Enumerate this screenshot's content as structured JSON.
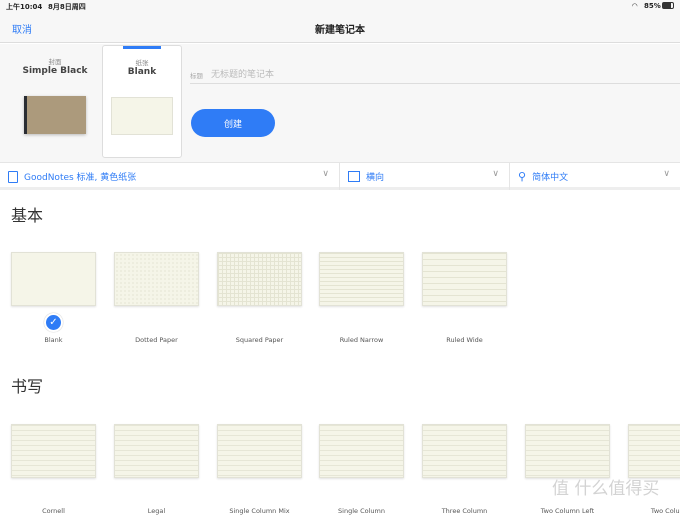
{
  "status": {
    "time": "上午10:04",
    "date": "8月8日周四",
    "battery": "85%"
  },
  "nav": {
    "cancel": "取消",
    "title": "新建笔记本"
  },
  "cover": {
    "caption": "封面",
    "name": "Simple Black"
  },
  "paper": {
    "caption": "纸张",
    "name": "Blank"
  },
  "title_field": {
    "label": "标题",
    "placeholder": "无标题的笔记本"
  },
  "create_button": "创建",
  "filters": {
    "template_set": "GoodNotes 标准, 黄色纸张",
    "orientation": "横向",
    "language": "简体中文"
  },
  "sections": [
    {
      "title": "基本",
      "items": [
        "Blank",
        "Dotted Paper",
        "Squared Paper",
        "Ruled Narrow",
        "Ruled Wide"
      ]
    },
    {
      "title": "书写",
      "items": [
        "Cornell",
        "Legal",
        "Single Column Mix",
        "Single Column",
        "Three Column",
        "Two Column Left",
        "Two Column"
      ]
    }
  ],
  "watermark": "值 什么值得买",
  "colors": {
    "accent": "#2f7cf6"
  }
}
